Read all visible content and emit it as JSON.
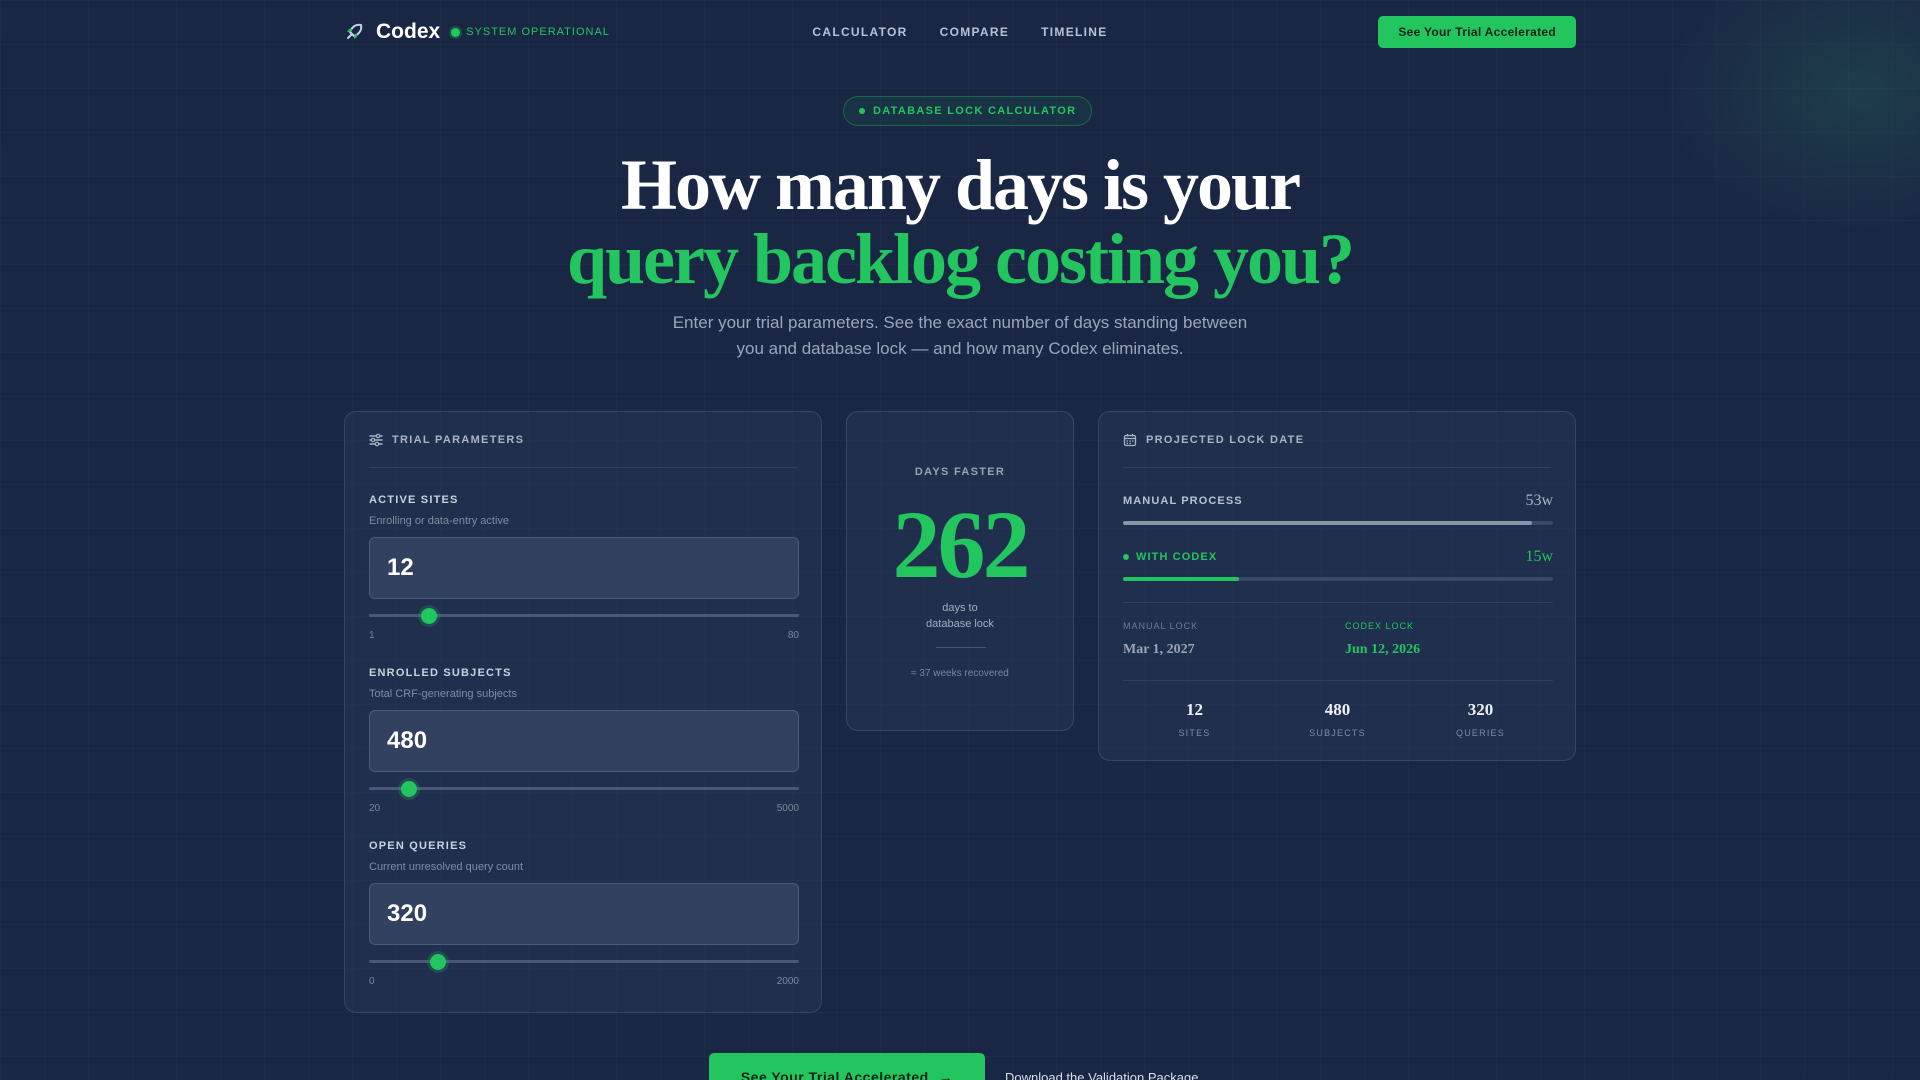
{
  "nav": {
    "brand": "Codex",
    "status": "SYSTEM OPERATIONAL",
    "links": [
      "CALCULATOR",
      "COMPARE",
      "TIMELINE"
    ],
    "cta": "See Your Trial Accelerated"
  },
  "hero": {
    "badge": "DATABASE LOCK CALCULATOR",
    "headline_line1": "How many days is your",
    "headline_line2": "query backlog costing you?",
    "subhead": "Enter your trial parameters. See the exact number of days standing between you and database lock — and how many Codex eliminates."
  },
  "params": {
    "title": "TRIAL PARAMETERS",
    "items": [
      {
        "label": "ACTIVE SITES",
        "hint": "Enrolling or data-entry active",
        "value": "12",
        "min": "1",
        "max": "80",
        "fraction": 0.14
      },
      {
        "label": "ENROLLED SUBJECTS",
        "hint": "Total CRF-generating subjects",
        "value": "480",
        "min": "20",
        "max": "5000",
        "fraction": 0.092
      },
      {
        "label": "OPEN QUERIES",
        "hint": "Current unresolved query count",
        "value": "320",
        "min": "0",
        "max": "2000",
        "fraction": 0.16
      }
    ]
  },
  "days": {
    "label": "DAYS FASTER",
    "value": "262",
    "sub_line1": "days to",
    "sub_line2": "database lock",
    "foot": "≈ 37 weeks recovered"
  },
  "projection": {
    "title": "PROJECTED LOCK DATE",
    "manual_label": "MANUAL PROCESS",
    "manual_value": "53w",
    "manual_fraction": 0.95,
    "codex_label": "WITH CODEX",
    "codex_value": "15w",
    "codex_fraction": 0.27,
    "manual_lock_label": "MANUAL LOCK",
    "manual_lock_date": "Mar 1, 2027",
    "codex_lock_label": "CODEX LOCK",
    "codex_lock_date": "Jun 12, 2026",
    "stats": [
      {
        "num": "12",
        "label": "SITES"
      },
      {
        "num": "480",
        "label": "SUBJECTS"
      },
      {
        "num": "320",
        "label": "QUERIES"
      }
    ]
  },
  "bottom": {
    "cta": "See Your Trial Accelerated",
    "secondary": "Download the Validation Package"
  },
  "colors": {
    "accent": "#22c55e",
    "background": "#1a2744",
    "manual_bar": "#8b95a8"
  }
}
